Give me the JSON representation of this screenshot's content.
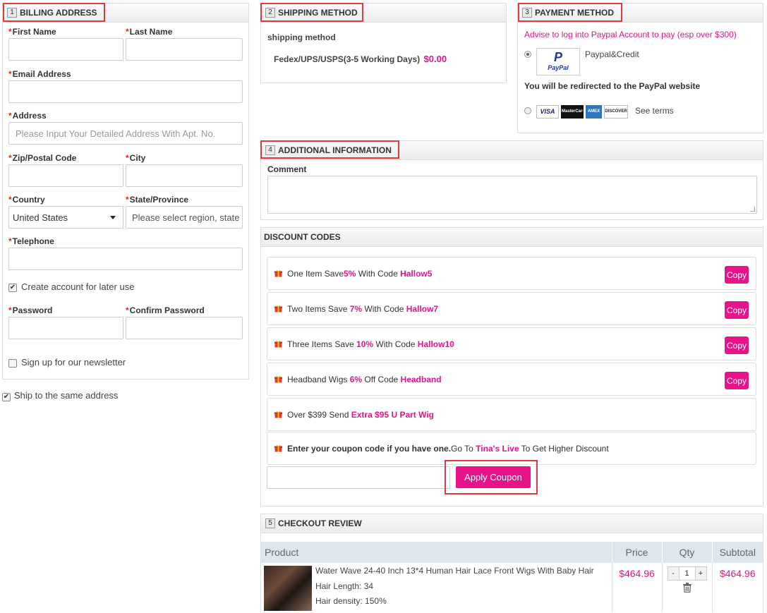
{
  "billing": {
    "step": "1",
    "title": "BILLING ADDRESS",
    "first_name_label": "First Name",
    "last_name_label": "Last Name",
    "email_label": "Email Address",
    "address_label": "Address",
    "address_placeholder": "Please Input Your Detailed Address With Apt. No.",
    "zip_label": "Zip/Postal Code",
    "city_label": "City",
    "country_label": "Country",
    "country_value": "United States",
    "state_label": "State/Province",
    "state_placeholder": "Please select region, state",
    "telephone_label": "Telephone",
    "create_account_label": "Create account for later use",
    "create_account_checked": true,
    "password_label": "Password",
    "confirm_password_label": "Confirm Password",
    "newsletter_label": "Sign up for our newsletter",
    "newsletter_checked": false
  },
  "ship_same_label": "Ship to the same address",
  "ship_same_checked": true,
  "shipping": {
    "step": "2",
    "title": "SHIPPING METHOD",
    "subtitle": "shipping method",
    "option_label": "Fedex/UPS/USPS(3-5 Working Days)",
    "option_price": "$0.00"
  },
  "payment": {
    "step": "3",
    "title": "PAYMENT METHOD",
    "advice": "Advise to log into Paypal Account to pay (esp over $300)",
    "paypal_label": "Paypal&Credit",
    "paypal_logo_text": "PayPal",
    "redirect_note": "You will be redirected to the PayPal website",
    "see_terms": "See terms",
    "cards": [
      "VISA",
      "MasterCard",
      "AMEX",
      "DISCOVER"
    ]
  },
  "additional": {
    "step": "4",
    "title": "ADDITIONAL INFORMATION",
    "comment_label": "Comment"
  },
  "discounts": {
    "title": "DISCOUNT CODES",
    "rows": [
      {
        "pre": "One Item Save ",
        "pct": "5%",
        "mid": " With Code ",
        "code": "Hallow5",
        "copy": "Copy"
      },
      {
        "pre": "Two Items Save ",
        "pct": "7%",
        "mid": " With Code ",
        "code": "Hallow7",
        "copy": "Copy"
      },
      {
        "pre": "Three Items Save ",
        "pct": "10%",
        "mid": " With Code ",
        "code": "Hallow10",
        "copy": "Copy"
      },
      {
        "pre": "Headband Wigs ",
        "pct": "6%",
        "mid": " Off Code ",
        "code": "Headband",
        "copy": "Copy"
      }
    ],
    "gift_row": {
      "pre": "Over $399 Send ",
      "highlight": "Extra $95 U Part Wig"
    },
    "coupon_row": {
      "bold": "Enter your coupon code if you have one.",
      "pre": "Go To ",
      "highlight": "Tina's Live",
      "post": " To Get Higher Discount"
    },
    "apply_label": "Apply Coupon"
  },
  "review": {
    "step": "5",
    "title": "CHECKOUT REVIEW",
    "headers": {
      "product": "Product",
      "price": "Price",
      "qty": "Qty",
      "subtotal": "Subtotal"
    },
    "items": [
      {
        "name": "Water Wave 24-40 Inch 13*4 Human Hair Lace Front Wigs With Baby Hair",
        "attr1_label": "Hair Length:",
        "attr1_value": "34",
        "attr2_label": "Hair density:",
        "attr2_value": "150%",
        "price": "$464.96",
        "qty": "1",
        "minus": "-",
        "plus": "+",
        "subtotal": "$464.96"
      }
    ]
  },
  "colors": {
    "accent": "#e8138b",
    "highlight_box": "#e23b3b"
  }
}
